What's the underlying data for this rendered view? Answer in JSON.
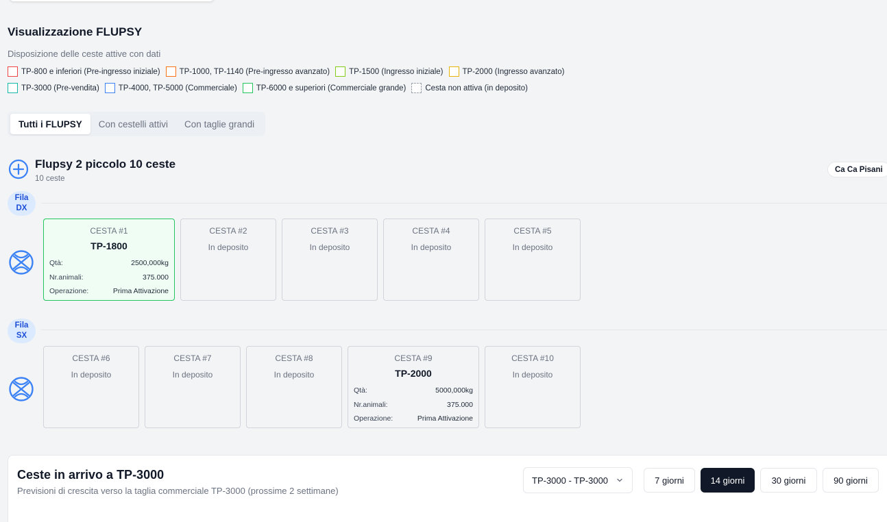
{
  "header": {
    "title": "Visualizzazione FLUPSY",
    "subtitle": "Disposizione delle ceste attive con dati"
  },
  "legend": [
    {
      "label": "TP-800 e inferiori (Pre-ingresso iniziale)",
      "color": "#ef4444"
    },
    {
      "label": "TP-1000, TP-1140 (Pre-ingresso avanzato)",
      "color": "#f97316"
    },
    {
      "label": "TP-1500 (Ingresso iniziale)",
      "color": "#84cc16"
    },
    {
      "label": "TP-2000 (Ingresso avanzato)",
      "color": "#eab308"
    },
    {
      "label": "TP-3000 (Pre-vendita)",
      "color": "#14b8a6"
    },
    {
      "label": "TP-4000, TP-5000 (Commerciale)",
      "color": "#3b82f6"
    },
    {
      "label": "TP-6000 e superiori (Commerciale grande)",
      "color": "#22c55e"
    },
    {
      "label": "Cesta non attiva (in deposito)",
      "color": "#9ca3af"
    }
  ],
  "tabs": [
    {
      "label": "Tutti i FLUPSY",
      "active": true
    },
    {
      "label": "Con cestelli attivi",
      "active": false
    },
    {
      "label": "Con taglie grandi",
      "active": false
    }
  ],
  "flupsy": {
    "name": "Flupsy 2 piccolo 10 ceste",
    "count": "10 ceste",
    "location": "Ca Ca Pisani",
    "rows": [
      {
        "label_line1": "Fila",
        "label_line2": "DX",
        "baskets": [
          {
            "name": "CESTA #1",
            "size": "TP-1800",
            "qty_label": "Qtà:",
            "qty": "2500,000kg",
            "animals_label": "Nr.animali:",
            "animals": "375.000",
            "op_label": "Operazione:",
            "op": "Prima Attivazione"
          },
          {
            "name": "CESTA #2",
            "status": "In deposito"
          },
          {
            "name": "CESTA #3",
            "status": "In deposito"
          },
          {
            "name": "CESTA #4",
            "status": "In deposito"
          },
          {
            "name": "CESTA #5",
            "status": "In deposito"
          }
        ]
      },
      {
        "label_line1": "Fila",
        "label_line2": "SX",
        "baskets": [
          {
            "name": "CESTA #6",
            "status": "In deposito"
          },
          {
            "name": "CESTA #7",
            "status": "In deposito"
          },
          {
            "name": "CESTA #8",
            "status": "In deposito"
          },
          {
            "name": "CESTA #9",
            "size": "TP-2000",
            "qty_label": "Qtà:",
            "qty": "5000,000kg",
            "animals_label": "Nr.animali:",
            "animals": "375.000",
            "op_label": "Operazione:",
            "op": "Prima Attivazione"
          },
          {
            "name": "CESTA #10",
            "status": "In deposito"
          }
        ]
      }
    ]
  },
  "arrivals": {
    "title": "Ceste in arrivo a TP-3000",
    "subtitle": "Previsioni di crescita verso la taglia commerciale TP-3000 (prossime 2 settimane)",
    "select_value": "TP-3000 - TP-3000",
    "day_buttons": [
      {
        "label": "7 giorni",
        "active": false
      },
      {
        "label": "14 giorni",
        "active": true
      },
      {
        "label": "30 giorni",
        "active": false
      },
      {
        "label": "90 giorni",
        "active": false
      }
    ]
  },
  "colors": {
    "accent_blue": "#3b82f6",
    "active_basket_border": "#22c55e",
    "active_basket_bg": "#f0fdf4"
  }
}
